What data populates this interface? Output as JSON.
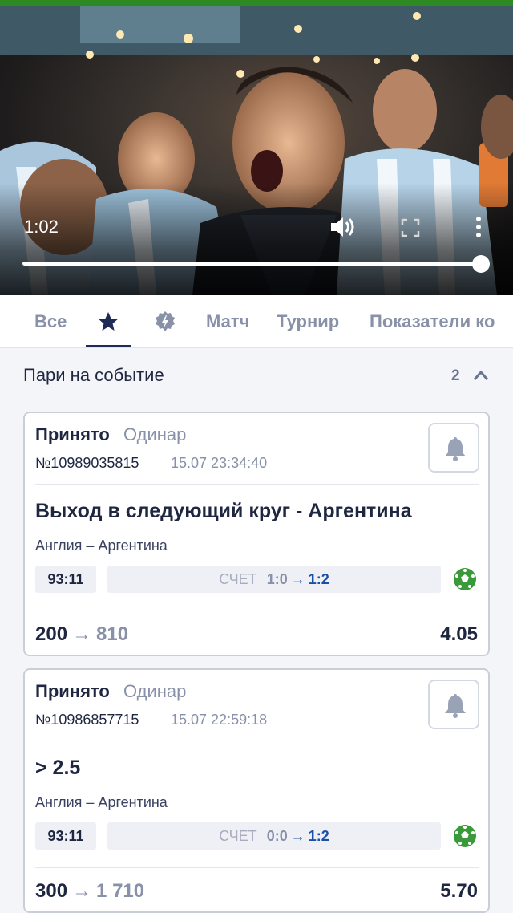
{
  "video": {
    "time": "1:02",
    "progress": 1.0,
    "icons": [
      "volume-icon",
      "fullscreen-icon",
      "more-vert-icon"
    ]
  },
  "tabs": [
    {
      "label": "Все",
      "active": false
    },
    {
      "icon": "star-icon",
      "active": true
    },
    {
      "icon": "lightning-gear-icon",
      "active": false
    },
    {
      "label": "Матч",
      "active": false
    },
    {
      "label": "Турнир",
      "active": false
    },
    {
      "label": "Показатели ко",
      "active": false
    }
  ],
  "section": {
    "title": "Пари на событие",
    "count": "2"
  },
  "bets": [
    {
      "status": "Принято",
      "kind": "Одинар",
      "number": "№10989035815",
      "datetime": "15.07 23:34:40",
      "market": "Выход в следующий круг - Аргентина",
      "teams": "Англия – Аргентина",
      "minute": "93:11",
      "score_label": "СЧЕТ",
      "score_from": "1:0",
      "score_arrow": "→",
      "score_to": "1:2",
      "stake": "200",
      "payout_arrow": "→",
      "payout": "810",
      "odds": "4.05"
    },
    {
      "status": "Принято",
      "kind": "Одинар",
      "number": "№10986857715",
      "datetime": "15.07 22:59:18",
      "market": "> 2.5",
      "teams": "Англия – Аргентина",
      "minute": "93:11",
      "score_label": "СЧЕТ",
      "score_from": "0:0",
      "score_arrow": "→",
      "score_to": "1:2",
      "stake": "300",
      "payout_arrow": "→",
      "payout": "1 710",
      "odds": "5.70"
    }
  ],
  "colors": {
    "top_accent": "#2d8a22",
    "text_dark": "#1f2740",
    "text_muted": "#8891a8",
    "score_blue": "#1a4fa8",
    "ball_green": "#3a9a3a"
  }
}
